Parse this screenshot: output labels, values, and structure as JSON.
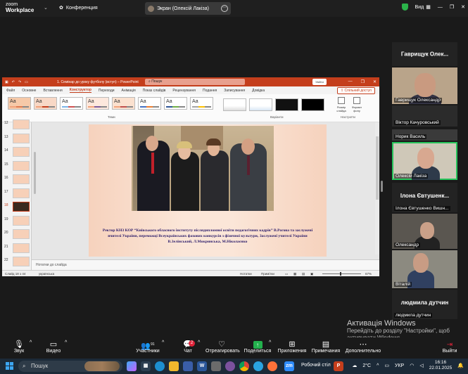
{
  "zoom": {
    "logo_line1": "zoom",
    "logo_line2": "Workplace",
    "conference": "Конференция",
    "share_title": "Экран (Олексій Лакіза)",
    "view_label": "Вид",
    "accent": "#27c45b"
  },
  "ppt": {
    "doc_title": "1. Семінар до уроку футболу (вступ) – PowerPoint",
    "search": "Пошук",
    "user_btn": "Увійти",
    "tabs": [
      "Файл",
      "Основне",
      "Вставлення",
      "Конструктор",
      "Переходи",
      "Анімація",
      "Показ слайдів",
      "Рецензування",
      "Подання",
      "Записування",
      "Довідка"
    ],
    "active_tab": "Конструктор",
    "share_btn": "Спільний доступ",
    "ribbon_groups": {
      "themes": "Теми",
      "variants": "Варіанти",
      "customize": "Настроїти"
    },
    "ribbon_buttons": {
      "slide_size": "Розмір слайда",
      "format_bg": "Формат фону"
    },
    "theme_label": "Аа",
    "slide_numbers": [
      "12",
      "13",
      "14",
      "15",
      "16",
      "17",
      "18",
      "19",
      "20",
      "21",
      "22"
    ],
    "selected_slide": "18",
    "caption": "Ректор КНЗ КОР “Київського обласного інституту післядипломної освіти педагогічних кадрів” В.Рогова та заслужені вчителі України, переможці Всеукраїнських фахових конкурсів з фізичної культури, Заслужені учителі України В.Зелінський, Л.Мокринська, М.Ніколаєнко",
    "notes_placeholder": "Нотатки до слайда",
    "status_slide": "Слайд 18 з 44",
    "status_lang": "українська",
    "status_notes": "Нотатки",
    "status_comments": "Примітки",
    "zoom_level": "67%",
    "accent": "#c43e1c"
  },
  "gallery": {
    "tiles": [
      {
        "kind": "name",
        "big": "Гаврищук Олек...",
        "name": ""
      },
      {
        "kind": "video",
        "big": "",
        "name": "Гаврищук Олександр"
      },
      {
        "kind": "video",
        "big": "",
        "name": "Віктор Качуровський"
      },
      {
        "kind": "video",
        "big": "",
        "name": "Норик Василь"
      },
      {
        "kind": "video",
        "big": "",
        "name": "Олексій Лакіза"
      },
      {
        "kind": "name",
        "big": "Ілона Євтушенк...",
        "name": "Ілона Євтушенко Вишн..."
      },
      {
        "kind": "video",
        "big": "",
        "name": "Олександр"
      },
      {
        "kind": "video",
        "big": "",
        "name": "Віталій"
      },
      {
        "kind": "name",
        "big": "людмила дутчин",
        "name": "людмила дутчин"
      }
    ]
  },
  "activate": {
    "title": "Активація Windows",
    "line1": "Перейдіть до розділу \"Настройки\", щоб",
    "line2": "активувати Windows."
  },
  "toolbar": {
    "audio": "Звук",
    "video": "Видео",
    "participants": "Участники",
    "participants_count": "91",
    "chat": "Чат",
    "chat_badge": "2",
    "react": "Отреагировать",
    "share": "Поделиться",
    "apps": "Приложения",
    "notes": "Примечания",
    "more": "Дополнительно",
    "leave": "Выйти"
  },
  "taskbar": {
    "search": "Пошук",
    "desktop": "Робочий стіл",
    "temp": "2°C",
    "lang": "УКР",
    "time": "16:16",
    "date": "22.01.2025"
  }
}
